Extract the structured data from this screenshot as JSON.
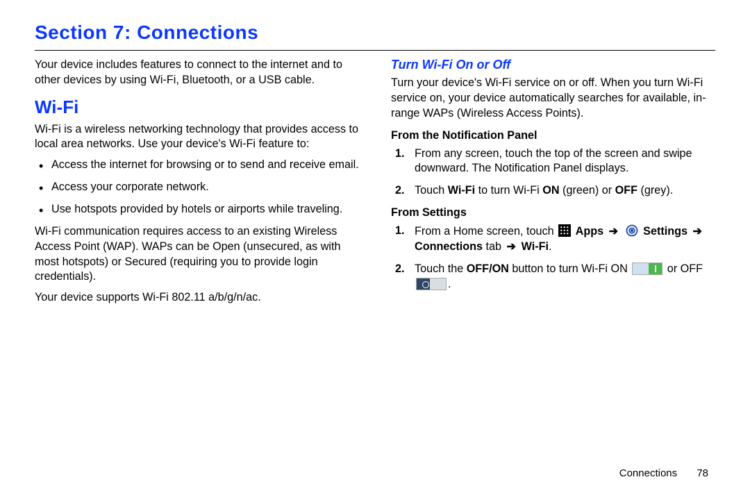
{
  "section_title": "Section 7: Connections",
  "left": {
    "intro": "Your device includes features to connect to the internet and to other devices by using Wi-Fi, Bluetooth, or a USB cable.",
    "wifi_heading": "Wi-Fi",
    "wifi_intro": "Wi-Fi is a wireless networking technology that provides access to local area networks. Use your device's Wi-Fi feature to:",
    "bullets": [
      "Access the internet for browsing or to send and receive email.",
      "Access your corporate network.",
      "Use hotspots provided by hotels or airports while traveling."
    ],
    "wap": "Wi-Fi communication requires access to an existing Wireless Access Point (WAP). WAPs can be Open (unsecured, as with most hotspots) or Secured (requiring you to provide login credentials).",
    "spec": "Your device supports Wi-Fi 802.11 a/b/g/n/ac."
  },
  "right": {
    "turn_heading": "Turn Wi-Fi On or Off",
    "turn_intro": "Turn your device's Wi-Fi service on or off. When you turn Wi-Fi service on, your device automatically searches for available, in-range WAPs (Wireless Access Points).",
    "notif_heading": "From the Notification Panel",
    "notif_steps": {
      "s1": "From any screen, touch the top of the screen and swipe downward. The Notification Panel displays.",
      "s2_a": "Touch ",
      "s2_wifi": "Wi-Fi",
      "s2_b": " to turn Wi-Fi ",
      "s2_on": "ON",
      "s2_c": " (green) or ",
      "s2_off": "OFF",
      "s2_d": " (grey)."
    },
    "settings_heading": "From Settings",
    "settings_steps": {
      "s1_a": "From a Home screen, touch ",
      "s1_apps": "Apps",
      "s1_settings": "Settings",
      "s1_conn": "Connections",
      "s1_tab": " tab ",
      "s1_wifi": "Wi-Fi",
      "s1_dot": ".",
      "arrow": "➔",
      "s2_a": "Touch the ",
      "s2_offon": "OFF/ON",
      "s2_b": " button to turn Wi-Fi ON ",
      "s2_c": " or OFF ",
      "s2_d": "."
    }
  },
  "footer": {
    "chapter": "Connections",
    "page": "78"
  }
}
